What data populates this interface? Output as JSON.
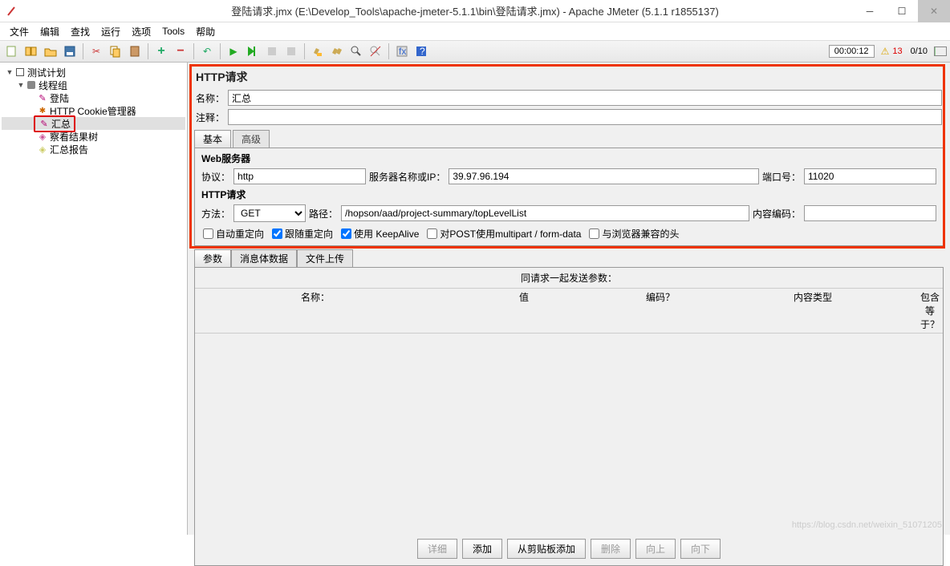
{
  "window": {
    "title": "登陆请求.jmx (E:\\Develop_Tools\\apache-jmeter-5.1.1\\bin\\登陆请求.jmx) - Apache JMeter (5.1.1 r1855137)"
  },
  "menu": {
    "file": "文件",
    "edit": "编辑",
    "search": "查找",
    "run": "运行",
    "options": "选项",
    "tools": "Tools",
    "help": "帮助"
  },
  "toolbar": {
    "timer": "00:00:12",
    "errors": "13",
    "ratio": "0/10"
  },
  "tree": {
    "plan": "测试计划",
    "thread": "线程组",
    "login": "登陆",
    "cookie": "HTTP Cookie管理器",
    "summary": "汇总",
    "viewtree": "察看结果树",
    "report": "汇总报告"
  },
  "panel": {
    "title": "HTTP请求",
    "name_label": "名称：",
    "name_value": "汇总",
    "comment_label": "注释：",
    "comment_value": "",
    "tab_basic": "基本",
    "tab_adv": "高级",
    "web_server": "Web服务器",
    "protocol_label": "协议：",
    "protocol_value": "http",
    "server_label": "服务器名称或IP：",
    "server_value": "39.97.96.194",
    "port_label": "端口号：",
    "port_value": "11020",
    "http_req": "HTTP请求",
    "method_label": "方法：",
    "method_value": "GET",
    "path_label": "路径：",
    "path_value": "/hopson/aad/project-summary/topLevelList",
    "enc_label": "内容编码：",
    "enc_value": "",
    "chk_auto": "自动重定向",
    "chk_follow": "跟随重定向",
    "chk_keepalive": "使用 KeepAlive",
    "chk_multipart": "对POST使用multipart / form-data",
    "chk_browser": "与浏览器兼容的头",
    "subtab_params": "参数",
    "subtab_body": "消息体数据",
    "subtab_files": "文件上传",
    "params_title": "同请求一起发送参数：",
    "col_name": "名称：",
    "col_value": "值",
    "col_encode": "编码？",
    "col_ct": "内容类型",
    "col_eq": "包含等于？",
    "btn_detail": "详细",
    "btn_add": "添加",
    "btn_clip": "从剪贴板添加",
    "btn_del": "删除",
    "btn_up": "向上",
    "btn_down": "向下"
  },
  "watermark": "https://blog.csdn.net/weixin_51071205"
}
